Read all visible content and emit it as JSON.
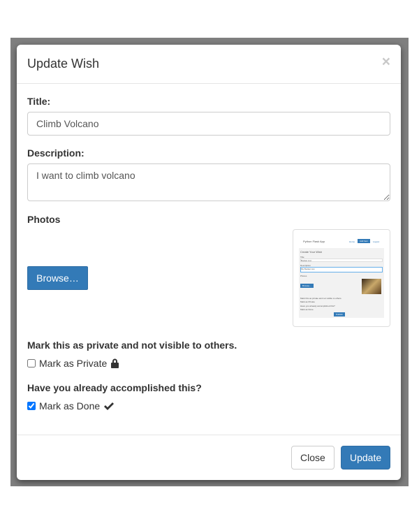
{
  "modal": {
    "title": "Update Wish",
    "close_icon": "×"
  },
  "form": {
    "title_label": "Title:",
    "title_value": "Climb Volcano",
    "description_label": "Description:",
    "description_value": "I want to climb volcano",
    "photos_label": "Photos",
    "browse_label": "Browse…",
    "private_heading": "Mark this as private and not visible to others.",
    "private_label": "Mark as Private",
    "private_checked": false,
    "done_heading": "Have you already accomplished this?",
    "done_label": "Mark as Done",
    "done_checked": true
  },
  "thumbnail": {
    "app": "Python Flask App",
    "nav": [
      "Home",
      "Add Item",
      "Logout"
    ],
    "heading": "Create Your Wish",
    "title": "Title",
    "title_value": "Bucket List",
    "description": "Description",
    "description_value": "My Bucket List",
    "photos": "Photos",
    "browse": "Browse...",
    "private": "Mark this as private and not visible to others.",
    "private_label": "Mark as Private",
    "done": "Have you already accomplished this?",
    "done_label": "Mark as Done",
    "publish": "Publish"
  },
  "footer": {
    "close_label": "Close",
    "update_label": "Update"
  },
  "colors": {
    "primary": "#337ab7",
    "backdrop": "#7f7f7f"
  }
}
